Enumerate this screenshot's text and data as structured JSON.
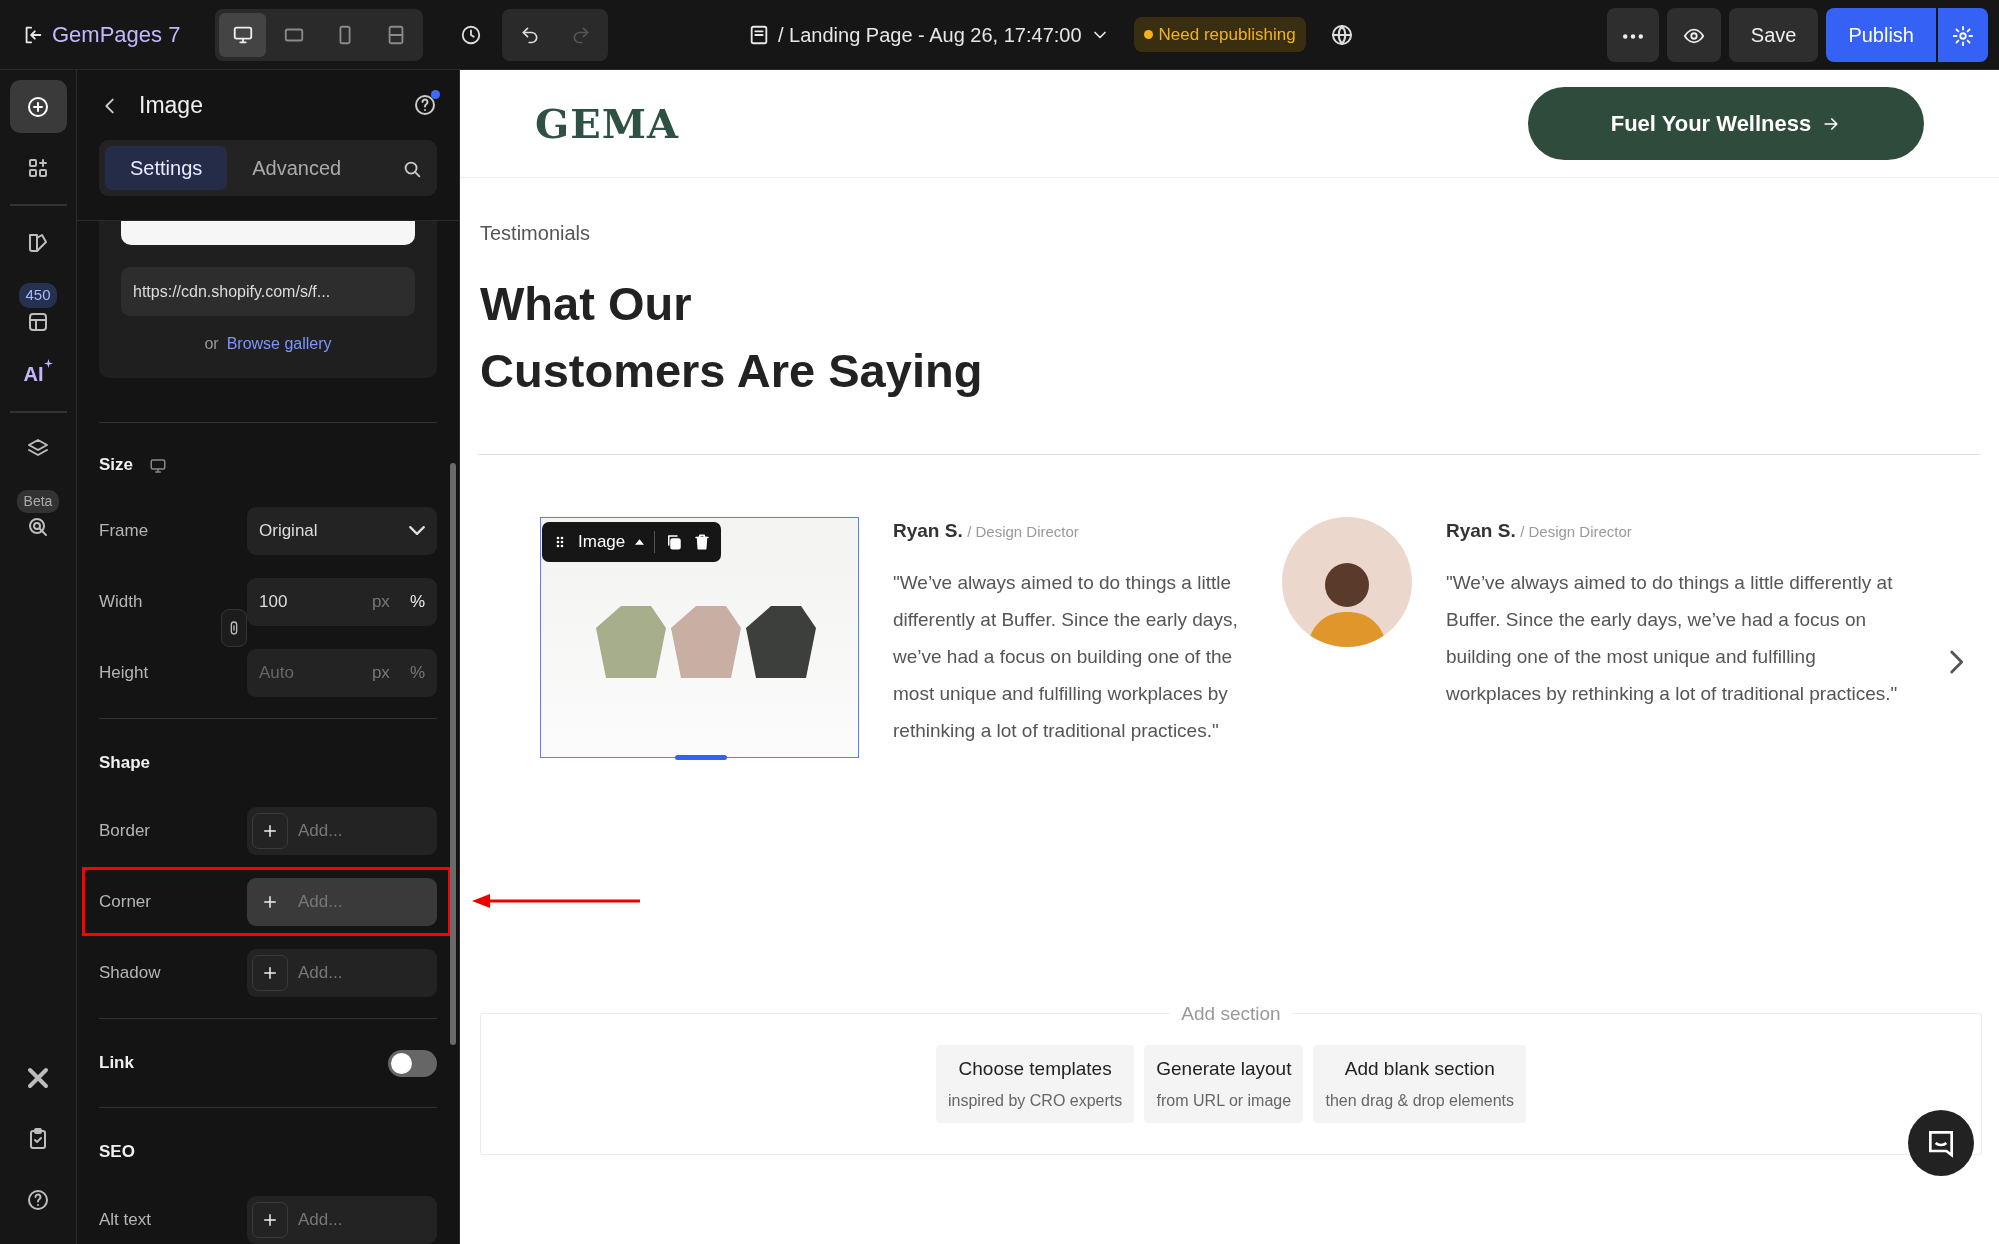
{
  "topbar": {
    "brand": "GemPages 7",
    "devices": [
      {
        "kind": "desktop",
        "selected": true
      },
      {
        "kind": "tablet",
        "selected": false
      },
      {
        "kind": "mobile",
        "selected": false
      },
      {
        "kind": "responsive",
        "selected": false
      }
    ],
    "redo_disabled": true,
    "page_title": "/ Landing Page - Aug 26, 17:47:00",
    "status_badge": "Need republishing",
    "save": "Save",
    "publish": "Publish"
  },
  "rail": {
    "groups": [
      [
        {
          "kind": "add",
          "selected": true
        },
        {
          "kind": "elements",
          "selected": false
        }
      ],
      [
        {
          "kind": "theme",
          "selected": false
        },
        {
          "kind": "templates",
          "badge": "450",
          "selected": false
        },
        {
          "kind": "ai",
          "label": "AI",
          "selected": false
        }
      ],
      [
        {
          "kind": "layers",
          "selected": false
        },
        {
          "kind": "heatmap",
          "badge": "Beta",
          "selected": false
        }
      ]
    ],
    "bottom": [
      {
        "kind": "xapp",
        "selected": false
      },
      {
        "kind": "checklist",
        "selected": false
      },
      {
        "kind": "help",
        "selected": false
      }
    ]
  },
  "panel": {
    "title": "Image",
    "tabs": [
      {
        "label": "Settings",
        "selected": true
      },
      {
        "label": "Advanced",
        "selected": false
      }
    ],
    "image_url": "https://cdn.shopify.com/s/f...",
    "browse_prefix": "or",
    "browse_link": "Browse gallery",
    "size": {
      "heading": "Size",
      "frame": {
        "label": "Frame",
        "value": "Original"
      },
      "width": {
        "label": "Width",
        "value": "100",
        "units": [
          {
            "label": "px",
            "selected": false
          },
          {
            "label": "%",
            "selected": true
          }
        ]
      },
      "height": {
        "label": "Height",
        "placeholder": "Auto",
        "units": [
          {
            "label": "px",
            "selected": false
          },
          {
            "label": "%",
            "selected": false
          }
        ]
      }
    },
    "shape": {
      "heading": "Shape",
      "rows": [
        {
          "label": "Border",
          "placeholder": "Add..."
        },
        {
          "label": "Corner",
          "placeholder": "Add...",
          "highlighted": true
        },
        {
          "label": "Shadow",
          "placeholder": "Add..."
        }
      ]
    },
    "link": {
      "label": "Link",
      "on": false
    },
    "seo": {
      "heading": "SEO",
      "rows": [
        {
          "label": "Alt text",
          "placeholder": "Add..."
        }
      ]
    }
  },
  "annotation_arrow": true,
  "canvas": {
    "logo": "GEMA",
    "cta": "Fuel Your Wellness",
    "eyebrow": "Testimonials",
    "heading": [
      "What Our",
      "Customers Are Saying"
    ],
    "testimonials": [
      {
        "kind": "product-photo",
        "selected": true,
        "name": "Ryan S.",
        "role": "/ Design Director",
        "quote": "\"We’ve always aimed to do things a little differently at Buffer. Since the early days, we’ve had a focus on building one of the most unique and fulfilling workplaces by rethinking a lot of traditional practices.\""
      },
      {
        "kind": "avatar",
        "name": "Ryan S.",
        "role": "/ Design Director",
        "quote": "\"We’ve always aimed to do things a little differently at Buffer. Since the early days, we’ve had a focus on building one of the most unique and fulfilling workplaces by rethinking a lot of traditional practices.\""
      }
    ],
    "element_toolbar": "Image",
    "add_section": {
      "label": "Add section",
      "options": [
        {
          "title": "Choose templates",
          "subtitle": "inspired by CRO experts"
        },
        {
          "title": "Generate layout",
          "subtitle": "from URL or image"
        },
        {
          "title": "Add blank section",
          "subtitle": "then drag & drop elements"
        }
      ]
    }
  }
}
